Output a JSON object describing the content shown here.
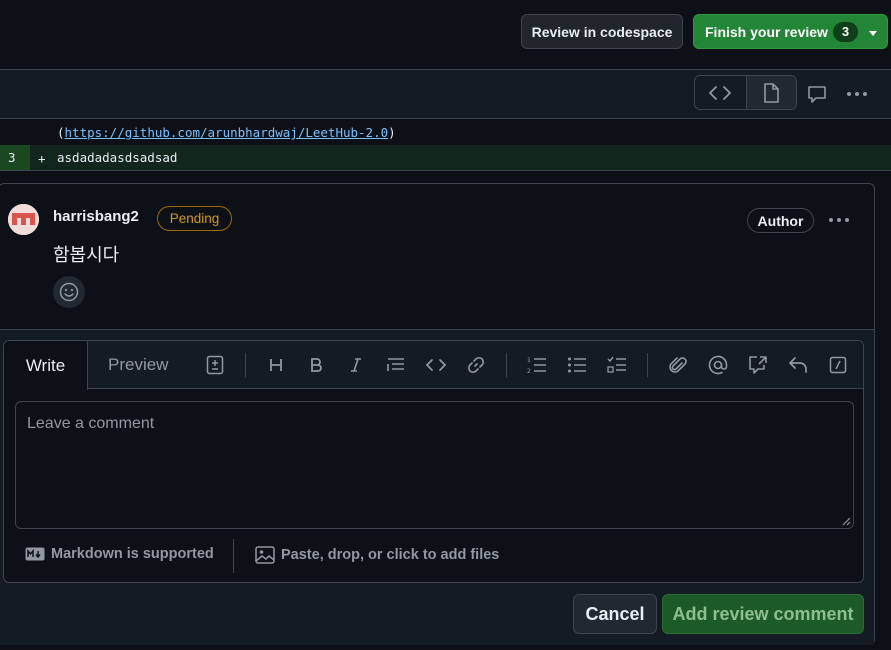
{
  "header": {
    "review_codespace_label": "Review in codespace",
    "finish_review_label": "Finish your review",
    "pending_count": "3"
  },
  "diff": {
    "line1_open": "(",
    "line1_link": "https://github.com/arunbhardwaj/LeetHub-2.0",
    "line1_close": ")",
    "line2_number": "3",
    "line2_marker": "+",
    "line2_text": "asdadadasdsadsad"
  },
  "comment": {
    "author": "harrisbang2",
    "pending_label": "Pending",
    "author_badge": "Author",
    "body": "함봅시다"
  },
  "reply": {
    "tab_write": "Write",
    "tab_preview": "Preview",
    "placeholder": "Leave a comment",
    "markdown_note": "Markdown is supported",
    "attach_note": "Paste, drop, or click to add files",
    "cancel_label": "Cancel",
    "submit_label": "Add review comment"
  },
  "colors": {
    "background": "#0d1117",
    "primary_green": "#238636",
    "pending_orange": "#d29922",
    "added_line_bg": "#12261e"
  },
  "icons": [
    "code-icon",
    "file-icon",
    "comment-icon",
    "kebab-icon",
    "smiley-icon",
    "heading-icon",
    "bold-icon",
    "italic-icon",
    "quote-icon",
    "link-icon",
    "ordered-list-icon",
    "unordered-list-icon",
    "task-list-icon",
    "paperclip-icon",
    "mention-icon",
    "cross-reference-icon",
    "reply-icon",
    "slash-command-icon",
    "markdown-icon",
    "image-icon"
  ]
}
